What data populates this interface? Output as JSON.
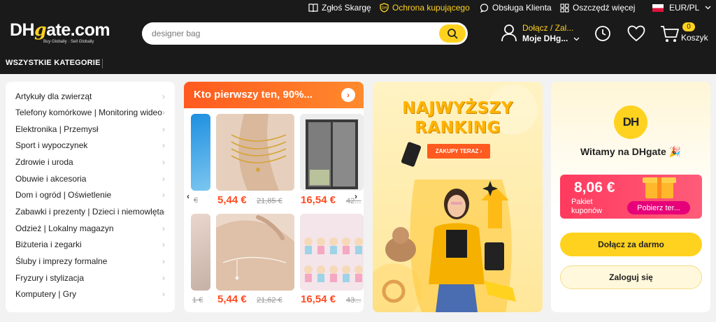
{
  "utility_bar": {
    "report": "Zgłoś Skargę",
    "buyer_protection": "Ochrona kupującego",
    "support": "Obsługa Klienta",
    "save_more": "Oszczędź więcej",
    "currency_locale": "EUR/PL"
  },
  "header": {
    "logo_text_dh": "DH",
    "logo_text_g": "g",
    "logo_text_rest": "ate.com",
    "logo_tagline": "Buy Globally · Sell Globally",
    "search_placeholder": "designer bag",
    "account_line1": "Dołącz / Zal...",
    "account_line2": "Moje DHg...",
    "cart_count": "0",
    "cart_label": "Koszyk"
  },
  "category_bar": {
    "all_categories": "WSZYSTKIE KATEGORIE"
  },
  "sidebar": {
    "items": [
      "Artykuły dla zwierząt",
      "Telefony komórkowe  |  Monitoring wideo",
      "Elektronika  |  Przemysł",
      "Sport i wypoczynek",
      "Zdrowie i uroda",
      "Obuwie i akcesoria",
      "Dom i ogród  |  Oświetlenie",
      "Zabawki i prezenty  |  Dzieci i niemowlęta",
      "Odzież  |  Lokalny magazyn",
      "Biżuteria i zegarki",
      "Śluby i imprezy formalne",
      "Fryzury i stylizacja",
      "Komputery  |  Gry"
    ]
  },
  "flash_deals": {
    "title": "Kto pierwszy ten, 90%...",
    "products": [
      {
        "price": "5,44 €",
        "old_price": "21,85 €"
      },
      {
        "price": "16,54 €",
        "old_price": "42..."
      },
      {
        "price": "5,44 €",
        "old_price": "21,62 €"
      },
      {
        "price": "16,54 €",
        "old_price": "43..."
      }
    ],
    "partial_left_top": "€",
    "partial_left_bottom": "1 €"
  },
  "promo": {
    "line1": "NAJWYŻSZY",
    "line2": "RANKING",
    "cta": "ZAKUPY TERAZ  ›"
  },
  "welcome": {
    "badge": "DH",
    "greeting": "Witamy na DHgate 🎉",
    "coupon_amount": "8,06 €",
    "coupon_label": "Pakiet kuponów",
    "coupon_button": "Pobierz ter...",
    "join_button": "Dołącz za darmo",
    "login_button": "Zaloguj się"
  },
  "colors": {
    "brand_yellow": "#ffd21f",
    "header_bg": "#1a1a1a",
    "price_orange": "#ff4a1f",
    "coupon_pink": "#ff3a5e"
  }
}
